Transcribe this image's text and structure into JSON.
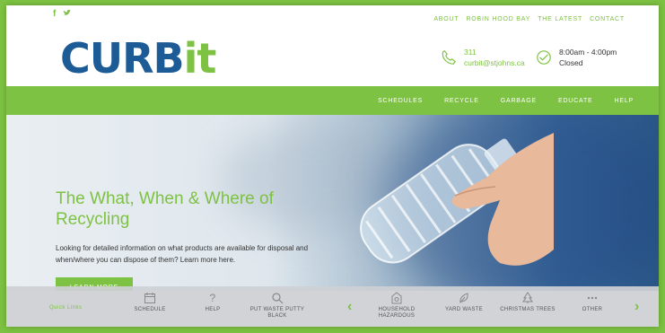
{
  "topbar": {
    "social": [
      "f",
      "t"
    ],
    "links": [
      "ABOUT",
      "ROBIN HOOD BAY",
      "THE LATEST",
      "CONTACT"
    ]
  },
  "logo": {
    "part1": "CURB",
    "part2": "it"
  },
  "contact": {
    "phone": "311",
    "email": "curbit@stjohns.ca",
    "icon": "phone-icon"
  },
  "hours": {
    "time": "8:00am - 4:00pm",
    "status": "Closed",
    "icon": "clock-icon"
  },
  "nav": {
    "items": [
      "SCHEDULES",
      "RECYCLE",
      "GARBAGE",
      "EDUCATE",
      "HELP"
    ]
  },
  "hero": {
    "title": "The What, When & Where of Recycling",
    "description": "Looking for detailed information on what products are available for disposal and when/where you can dispose of them? Learn more here.",
    "button": "LEARN MORE"
  },
  "quicklinks": {
    "label": "Quick Links",
    "items": [
      {
        "label": "SCHEDULE",
        "icon": "calendar-icon"
      },
      {
        "label": "HELP",
        "icon": "question-icon"
      },
      {
        "label": "PUT WASTE PUTTY BLACK",
        "icon": "search-icon"
      },
      {
        "label": "HOUSEHOLD HAZARDOUS",
        "icon": "hazard-icon"
      },
      {
        "label": "YARD WASTE",
        "icon": "leaf-icon"
      },
      {
        "label": "CHRISTMAS TREES",
        "icon": "tree-icon"
      },
      {
        "label": "OTHER",
        "icon": "more-icon"
      }
    ],
    "prev": "‹",
    "next": "›"
  },
  "colors": {
    "accent": "#7dc242",
    "brand_blue": "#1d5b96"
  }
}
